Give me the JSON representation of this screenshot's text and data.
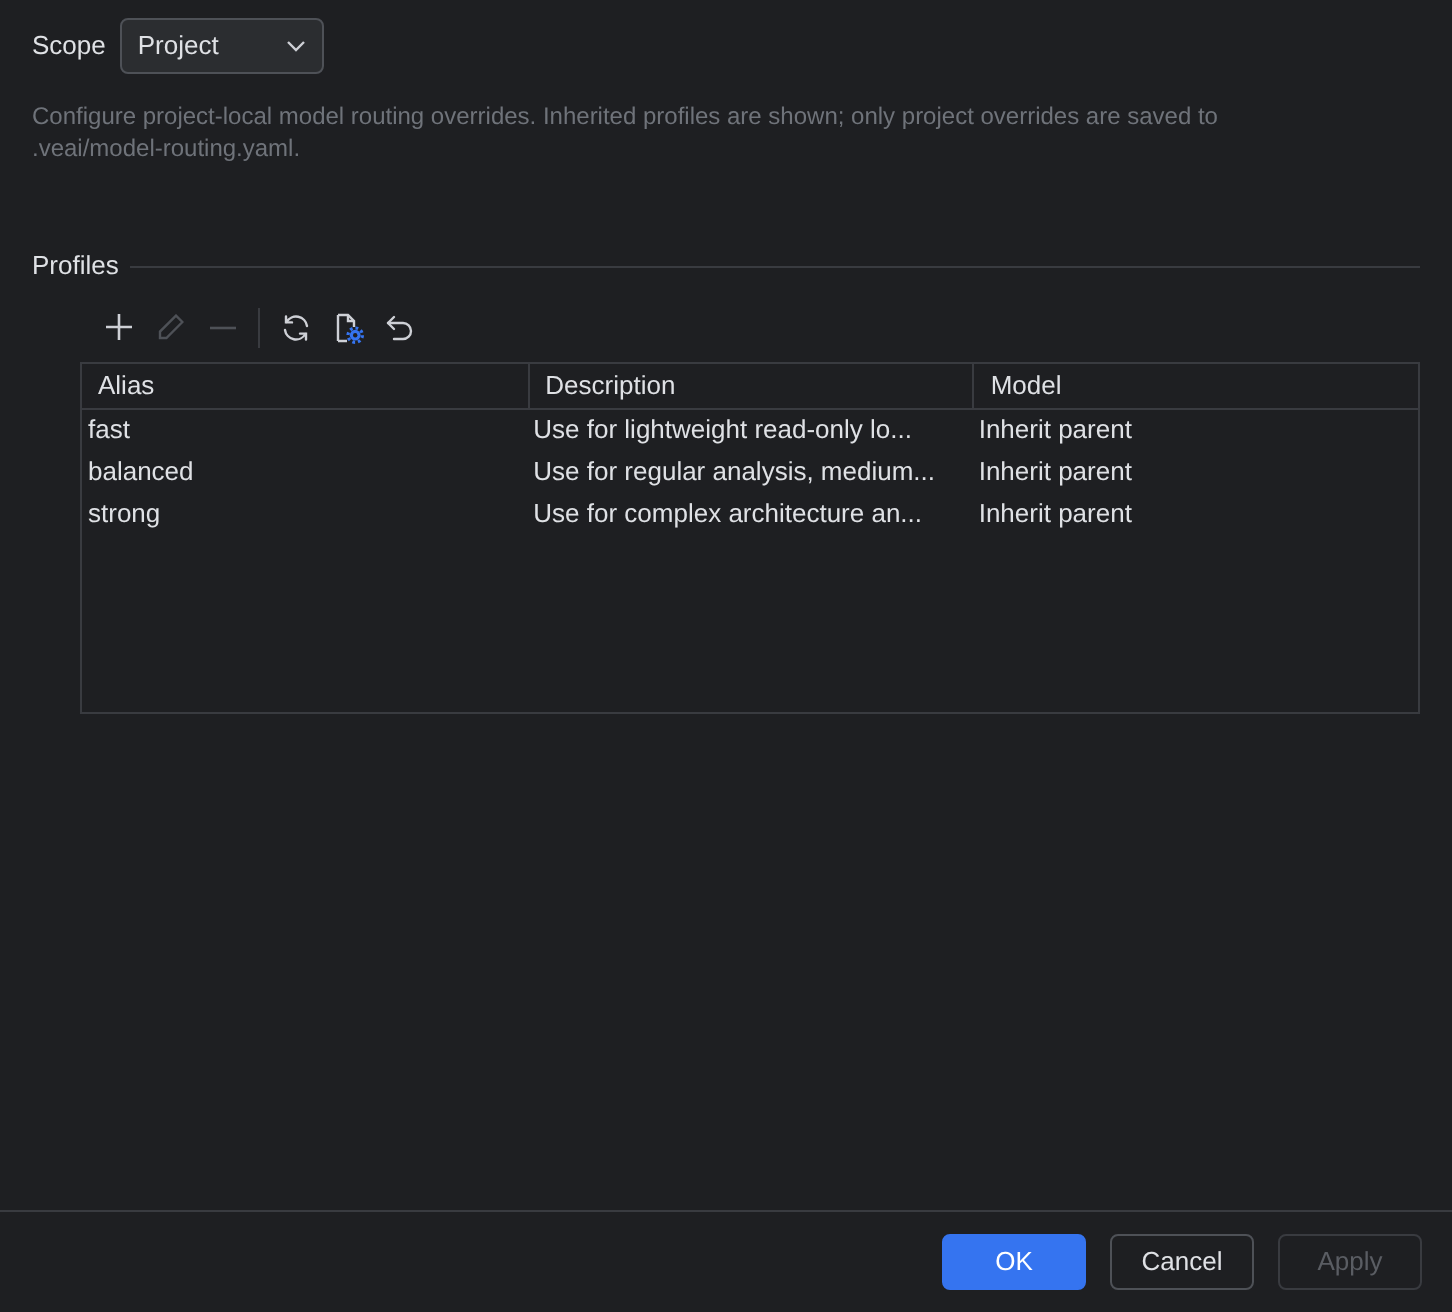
{
  "scope": {
    "label": "Scope",
    "value": "Project"
  },
  "description": [
    "Configure project-local model routing overrides. Inherited profiles are shown; only project overrides are saved to",
    ".veai/model-routing.yaml."
  ],
  "profiles": {
    "title": "Profiles",
    "toolbar": [
      [
        {
          "disabled": false
        },
        {
          "disabled": true
        },
        {
          "disabled": true
        }
      ],
      [
        {
          "disabled": false
        },
        {
          "disabled": false
        },
        {
          "disabled": false
        }
      ]
    ],
    "table": {
      "columns": [
        "Alias",
        "Description",
        "Model"
      ],
      "rows": [
        {
          "selected": false,
          "cells": [
            "fast",
            "Use for lightweight read-only lo...",
            "Inherit parent"
          ]
        },
        {
          "selected": false,
          "cells": [
            "balanced",
            "Use for regular analysis, medium...",
            "Inherit parent"
          ]
        },
        {
          "selected": false,
          "cells": [
            "strong",
            "Use for complex architecture an...",
            "Inherit parent"
          ]
        }
      ]
    }
  },
  "buttons": [
    {
      "label": "OK",
      "primary": true,
      "disabled": false
    },
    {
      "label": "Cancel",
      "primary": false,
      "disabled": false
    },
    {
      "label": "Apply",
      "primary": false,
      "disabled": true
    }
  ]
}
